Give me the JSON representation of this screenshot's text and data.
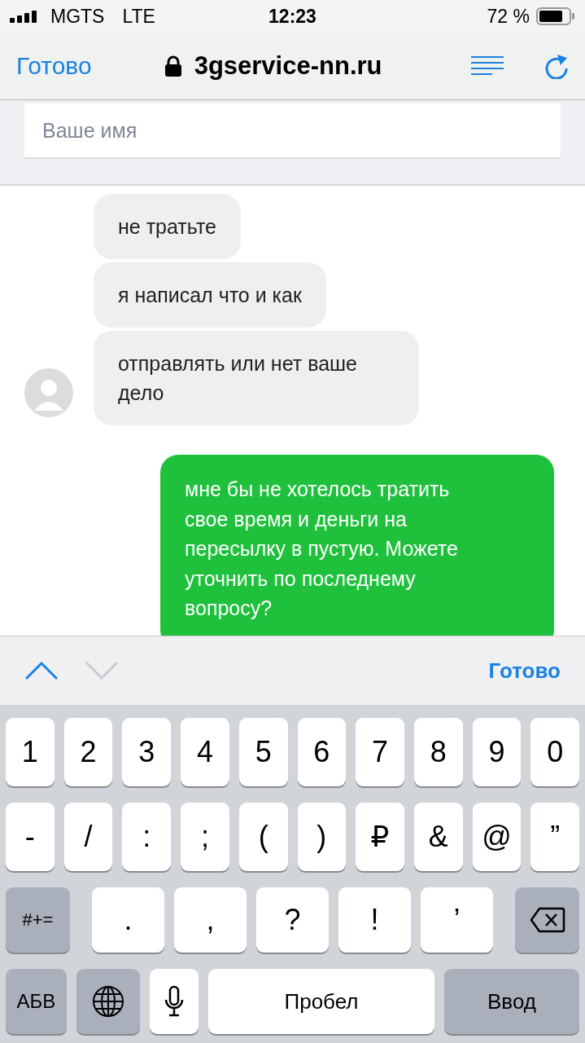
{
  "status_bar": {
    "carrier": "MGTS",
    "network": "LTE",
    "time": "12:23",
    "battery": "72 %"
  },
  "browser_bar": {
    "done": "Готово",
    "url": "3gservice-nn.ru"
  },
  "form": {
    "name_field": {
      "placeholder": "Ваше имя"
    }
  },
  "messages": [
    {
      "kind": "incoming",
      "text": "не тратьте",
      "show_avatar": false
    },
    {
      "kind": "incoming",
      "text": "я написал что и как",
      "show_avatar": false
    },
    {
      "kind": "incoming",
      "text": "отправлять или нет ваше дело",
      "show_avatar": true
    },
    {
      "kind": "outgoing",
      "text": "мне бы не хотелось тратить свое время и деньги на пересылку в пустую. Можете уточнить по последнему вопросу?"
    }
  ],
  "accessory_bar": {
    "previous": {
      "disabled": false
    },
    "next": {
      "disabled": true
    },
    "done": "Готово"
  },
  "keyboard": {
    "rows": [
      {
        "keys": [
          {
            "kind": "char",
            "label": "1"
          },
          {
            "kind": "char",
            "label": "2"
          },
          {
            "kind": "char",
            "label": "3"
          },
          {
            "kind": "char",
            "label": "4"
          },
          {
            "kind": "char",
            "label": "5"
          },
          {
            "kind": "char",
            "label": "6"
          },
          {
            "kind": "char",
            "label": "7"
          },
          {
            "kind": "char",
            "label": "8"
          },
          {
            "kind": "char",
            "label": "9"
          },
          {
            "kind": "char",
            "label": "0"
          }
        ]
      },
      {
        "keys": [
          {
            "kind": "char",
            "label": "-"
          },
          {
            "kind": "char",
            "label": "/"
          },
          {
            "kind": "char",
            "label": ":"
          },
          {
            "kind": "char",
            "label": ";"
          },
          {
            "kind": "char",
            "label": "("
          },
          {
            "kind": "char",
            "label": ")"
          },
          {
            "kind": "char",
            "label": "₽"
          },
          {
            "kind": "char",
            "label": "&"
          },
          {
            "kind": "char",
            "label": "@"
          },
          {
            "kind": "char",
            "label": "”"
          }
        ]
      },
      {
        "keys": [
          {
            "kind": "shift",
            "label": "#+="
          },
          {
            "kind": "char",
            "label": "."
          },
          {
            "kind": "char",
            "label": ","
          },
          {
            "kind": "char",
            "label": "?"
          },
          {
            "kind": "char",
            "label": "!"
          },
          {
            "kind": "char",
            "label": "’"
          },
          {
            "kind": "delete"
          }
        ]
      },
      {
        "keys": [
          {
            "kind": "abc",
            "label": "АБВ"
          },
          {
            "kind": "globe"
          },
          {
            "kind": "mic"
          },
          {
            "kind": "space",
            "label": "Пробел"
          },
          {
            "kind": "return",
            "label": "Ввод"
          }
        ]
      }
    ]
  }
}
